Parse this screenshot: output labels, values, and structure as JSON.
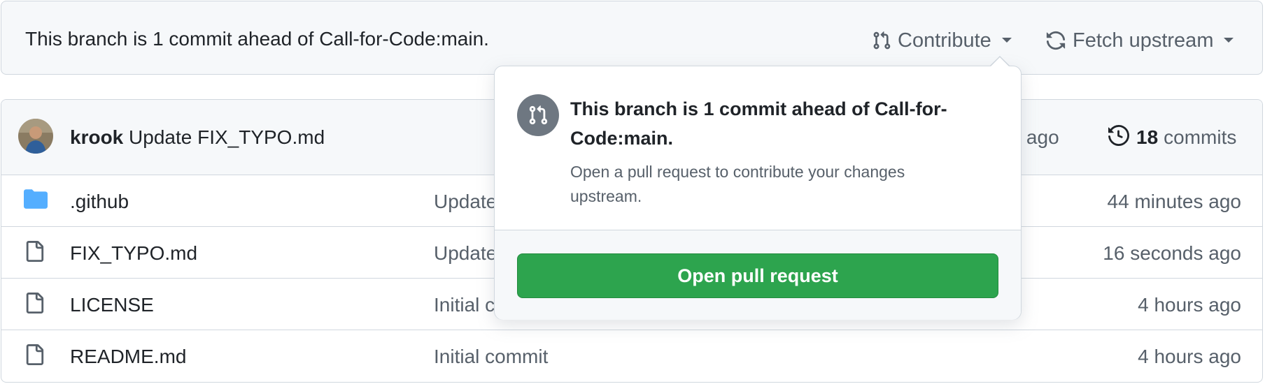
{
  "branch_bar": {
    "status_text": "This branch is 1 commit ahead of Call-for-Code:main.",
    "contribute_label": "Contribute",
    "fetch_label": "Fetch upstream"
  },
  "commit_header": {
    "author": "krook",
    "message": "Update FIX_TYPO.md",
    "time_partial": "nds ago",
    "commit_count": "18",
    "commits_label": "commits"
  },
  "files": [
    {
      "name": ".github",
      "type": "folder",
      "commit_msg": "Update",
      "time": "44 minutes ago"
    },
    {
      "name": "FIX_TYPO.md",
      "type": "file",
      "commit_msg": "Update",
      "time": "16 seconds ago"
    },
    {
      "name": "LICENSE",
      "type": "file",
      "commit_msg": "Initial c",
      "time": "4 hours ago"
    },
    {
      "name": "README.md",
      "type": "file",
      "commit_msg": "Initial commit",
      "time": "4 hours ago"
    }
  ],
  "popover": {
    "title": "This branch is 1 commit ahead of Call-for-Code:main.",
    "description": "Open a pull request to contribute your changes upstream.",
    "button_label": "Open pull request"
  },
  "colors": {
    "accent_green": "#2da44e",
    "folder_blue": "#54aeff",
    "muted_text": "#57606a",
    "icon_circle": "#6e7781"
  }
}
